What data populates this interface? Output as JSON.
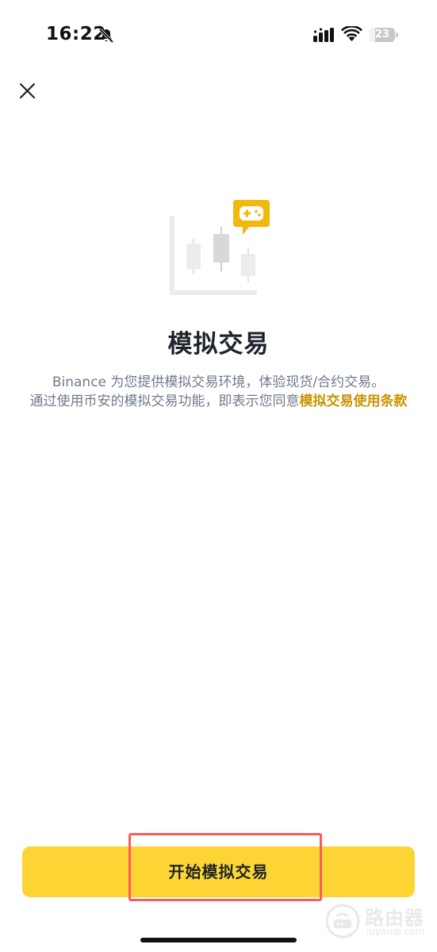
{
  "status_bar": {
    "time": "16:22",
    "battery_level": "23",
    "battery_fraction": 0.23,
    "icons": [
      "bell-off-icon",
      "cellular-signal-icon",
      "wifi-icon",
      "battery-icon"
    ]
  },
  "header": {
    "close_icon": "close-icon"
  },
  "illustration": {
    "icon": "candlestick-chart-gamepad-icon",
    "accent_color": "#f0b90b"
  },
  "main": {
    "title": "模拟交易",
    "description_line1": "Binance 为您提供模拟交易环境，体验现货/合约交易。",
    "description_line2": "通过使用币安的模拟交易功能，即表示您同意",
    "terms_link": "模拟交易使用条款"
  },
  "footer": {
    "start_button_label": "开始模拟交易",
    "button_color": "#fcd535",
    "highlight_color": "#ff5a5a"
  },
  "watermark": {
    "title": "路由器",
    "url": "luyouqi.com"
  }
}
